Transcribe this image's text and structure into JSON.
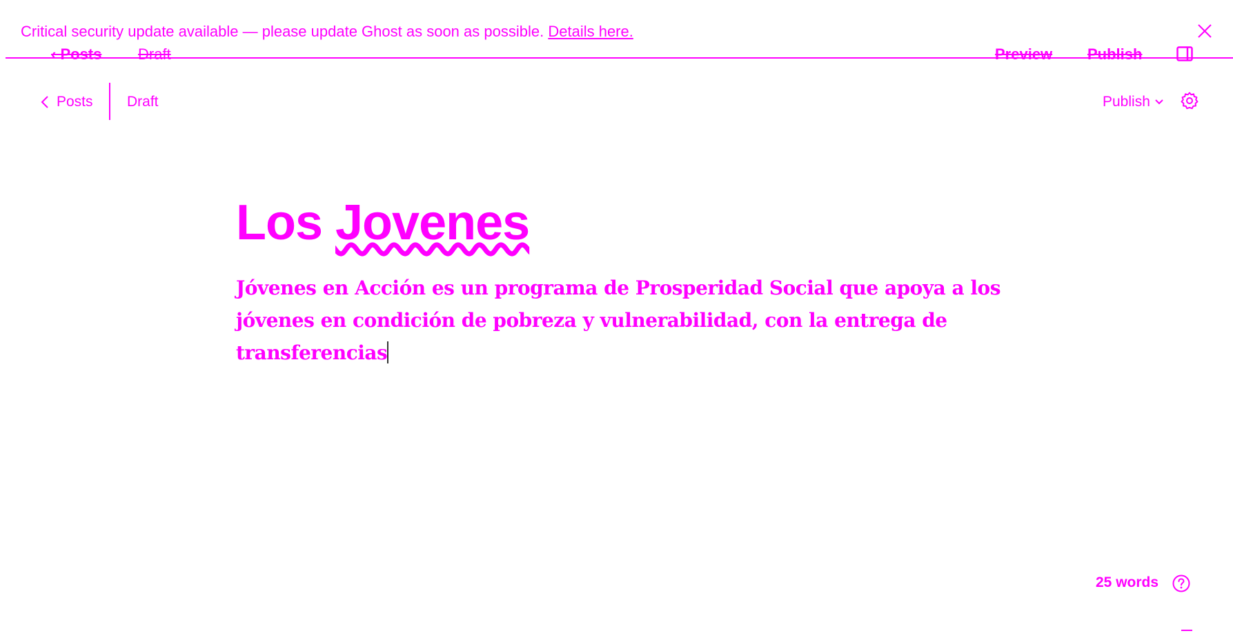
{
  "notice": {
    "message": "Critical security update available — please update Ghost as soon as possible.",
    "link_label": "Details here."
  },
  "ghost_nav": {
    "posts_label": "Posts",
    "draft_label": "Draft",
    "preview_label": "Preview",
    "publish_label": "Publish"
  },
  "header": {
    "back_label": "Posts",
    "status_label": "Draft",
    "publish_label": "Publish"
  },
  "post": {
    "title_prefix": "Los ",
    "title_word": "Jovenes",
    "body": "Jóvenes en Acción es un programa de Prosperidad Social que apoya a los jóvenes en condición de pobreza y vulnerabilidad, con la entrega de transferencias"
  },
  "footer": {
    "word_count": "25 words"
  },
  "colors": {
    "accent": "#ff00ff"
  },
  "icons": {
    "close": "close-icon",
    "back": "chevron-left-icon",
    "chevron_down": "chevron-down-icon",
    "settings": "gear-icon",
    "help": "question-circle-icon",
    "panel": "sidebar-panel-icon"
  }
}
